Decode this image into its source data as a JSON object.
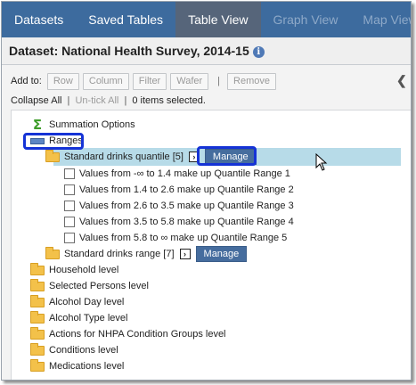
{
  "tabs": [
    {
      "label": "Datasets"
    },
    {
      "label": "Saved Tables"
    },
    {
      "label": "Table View"
    },
    {
      "label": "Graph View"
    },
    {
      "label": "Map View"
    }
  ],
  "dataset_title": "Dataset: National Health Survey, 2014-15",
  "info_glyph": "i",
  "toolbar": {
    "add_to_label": "Add to:",
    "row_label": "Row",
    "column_label": "Column",
    "filter_label": "Filter",
    "wafer_label": "Wafer",
    "separator": "|",
    "remove_label": "Remove"
  },
  "tree_controls": {
    "collapse_all": "Collapse All",
    "untick_all": "Un-tick All",
    "separator": "|",
    "selected_text": "0 items selected."
  },
  "tree": {
    "summation": "Summation Options",
    "ranges": "Ranges",
    "quantile": "Standard drinks quantile [5]",
    "quantile_manage": "Manage",
    "quantile_items": [
      "Values from -∞ to 1.4 make up Quantile Range 1",
      "Values from 1.4 to 2.6 make up Quantile Range 2",
      "Values from 2.6 to 3.5 make up Quantile Range 3",
      "Values from 3.5 to 5.8 make up Quantile Range 4",
      "Values from 5.8 to ∞ make up Quantile Range 5"
    ],
    "range": "Standard drinks range [7]",
    "range_manage": "Manage",
    "levels": [
      "Household level",
      "Selected Persons level",
      "Alcohol Day level",
      "Alcohol Type level",
      "Actions for NHPA Condition Groups level",
      "Conditions level",
      "Medications level"
    ]
  },
  "icons": {
    "summation": "sigma-icon",
    "ranges": "ranges-icon",
    "folder": "folder-icon",
    "expand_arrow": "arrow-right-icon",
    "collapse_panel": "chevron-left-icon"
  },
  "colors": {
    "tab_bar": "#3d6b9e",
    "tab_active": "#56657a",
    "manage_button": "#466d9e",
    "highlight_row": "#b7dbe8",
    "annotation_outline": "#1533d6"
  }
}
